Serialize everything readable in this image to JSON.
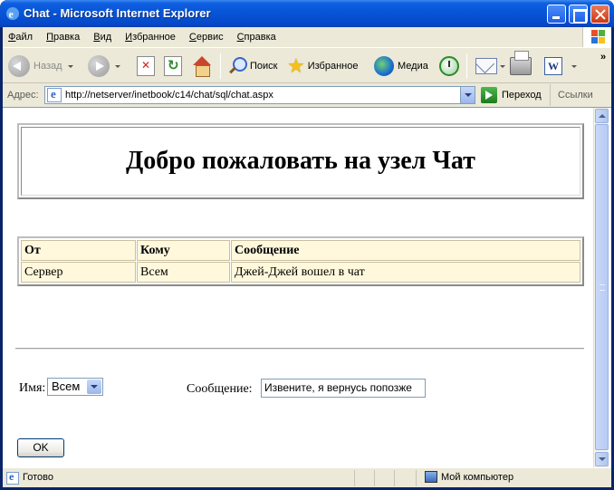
{
  "window": {
    "title": "Chat - Microsoft Internet Explorer"
  },
  "menubar": {
    "items": [
      {
        "hotkey": "Ф",
        "rest": "айл"
      },
      {
        "hotkey": "П",
        "rest": "равка"
      },
      {
        "hotkey": "В",
        "rest": "ид"
      },
      {
        "hotkey": "И",
        "rest": "збранное"
      },
      {
        "hotkey": "С",
        "rest": "ервис"
      },
      {
        "hotkey": "С",
        "rest": "правка"
      }
    ]
  },
  "toolbar": {
    "back_label": "Назад",
    "search_label": "Поиск",
    "favorites_label": "Избранное",
    "media_label": "Медиа"
  },
  "address": {
    "label": "Адрес:",
    "url": "http://netserver/inetbook/c14/chat/sql/chat.aspx",
    "go_label": "Переход",
    "links_label": "Ссылки"
  },
  "page": {
    "welcome_title": "Добро пожаловать на узел Чат",
    "table": {
      "headers": [
        "От",
        "Кому",
        "Сообщение"
      ],
      "rows": [
        [
          "Сервер",
          "Всем",
          "Джей-Джей вошел в чат"
        ]
      ]
    },
    "form": {
      "name_label": "Имя:",
      "name_selected": "Всем",
      "message_label": "Сообщение:",
      "message_value": "Извените, я вернусь попозже",
      "ok_label": "OK"
    }
  },
  "status": {
    "text": "Готово",
    "zone": "Мой компьютер"
  }
}
